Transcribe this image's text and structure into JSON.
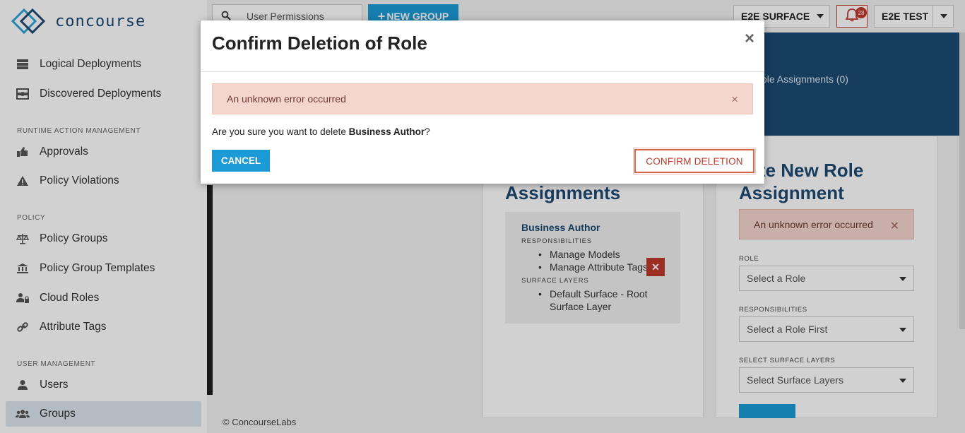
{
  "app": {
    "logo_text": "concourse"
  },
  "sidebar": {
    "items": [
      {
        "label": "Logical Deployments",
        "icon": "server-icon"
      },
      {
        "label": "Discovered Deployments",
        "icon": "discovered-icon"
      },
      {
        "label": "Approvals",
        "icon": "thumbs-up-icon"
      },
      {
        "label": "Policy Violations",
        "icon": "warning-icon"
      },
      {
        "label": "Policy Groups",
        "icon": "balance-scale-icon"
      },
      {
        "label": "Policy Group Templates",
        "icon": "institution-icon"
      },
      {
        "label": "Cloud Roles",
        "icon": "user-lock-icon"
      },
      {
        "label": "Attribute Tags",
        "icon": "link-icon"
      },
      {
        "label": "Users",
        "icon": "user-icon"
      },
      {
        "label": "Groups",
        "icon": "users-icon",
        "active": true
      }
    ],
    "sections": {
      "runtime": "RUNTIME ACTION MANAGEMENT",
      "policy": "POLICY",
      "user_mgmt": "USER MANAGEMENT"
    }
  },
  "topbar": {
    "search_value": "User Permissions",
    "new_group_label": "NEW GROUP",
    "surface_label": "E2E SURFACE",
    "notification_count": "28",
    "tenant_label": "E2E TEST"
  },
  "main": {
    "hero_text": "ole Assignments (0)",
    "assignments_title": "Assignments",
    "assignment": {
      "name": "Business Author",
      "responsibilities_label": "RESPONSIBILITIES",
      "responsibilities": [
        "Manage Models",
        "Manage Attribute Tags"
      ],
      "surface_layers_label": "SURFACE LAYERS",
      "surface_layers": [
        "Default Surface - Root",
        "Surface Layer"
      ]
    },
    "create_title_1": "eate New Role",
    "create_title_2": "Assignment",
    "error_text": "An unknown error occurred",
    "role_label": "ROLE",
    "role_placeholder": "Select a Role",
    "responsibilities_label": "RESPONSIBILITIES",
    "responsibilities_placeholder": "Select a Role First",
    "surface_layers_label": "SELECT SURFACE LAYERS",
    "surface_layers_placeholder": "Select Surface Layers"
  },
  "footer": {
    "text": "© ConcourseLabs"
  },
  "modal": {
    "title": "Confirm Deletion of Role",
    "error_text": "An unknown error occurred",
    "question_prefix": "Are you sure you want to delete ",
    "question_role": "Business Author",
    "question_suffix": "?",
    "cancel_label": "CANCEL",
    "confirm_label": "CONFIRM DELETION",
    "close_glyph": "×",
    "error_close_glyph": "×"
  },
  "colors": {
    "brand_navy": "#1c4a73",
    "accent_blue": "#1a9bd7",
    "danger": "#c0392b",
    "error_bg": "#f4d6cf"
  }
}
